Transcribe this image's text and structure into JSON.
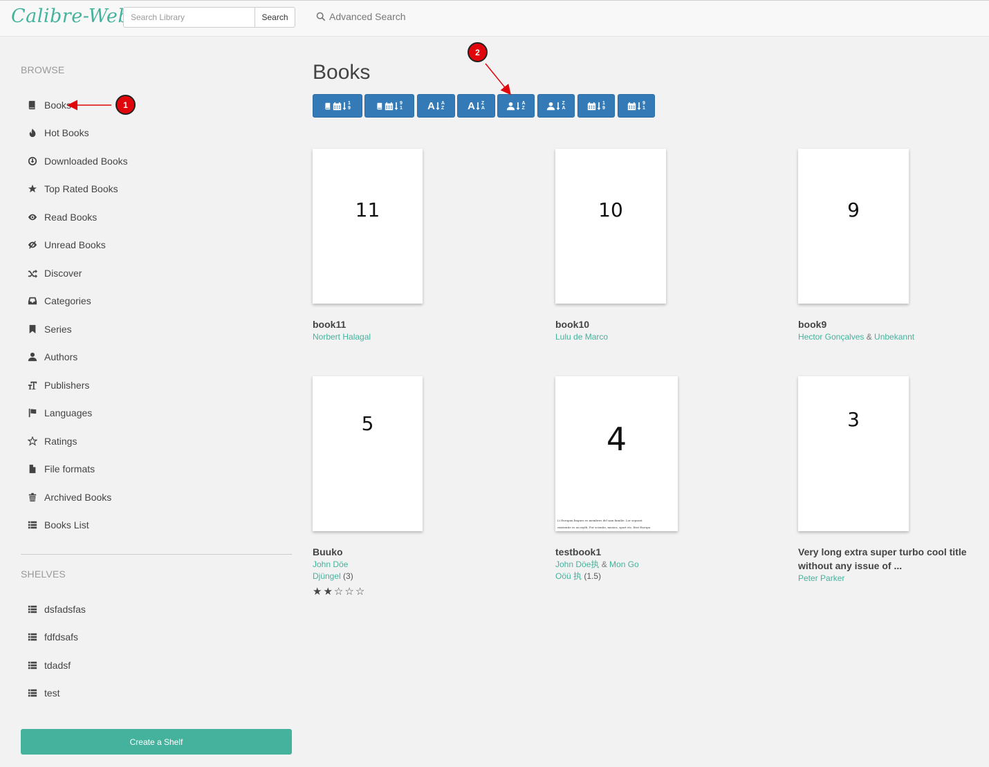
{
  "header": {
    "brand": "Calibre-Web",
    "search_placeholder": "Search Library",
    "search_button": "Search",
    "advanced_search": "Advanced Search"
  },
  "sidebar": {
    "browse_heading": "BROWSE",
    "items": [
      {
        "label": "Books",
        "icon": "book-icon"
      },
      {
        "label": "Hot Books",
        "icon": "fire-icon"
      },
      {
        "label": "Downloaded Books",
        "icon": "download-icon"
      },
      {
        "label": "Top Rated Books",
        "icon": "star-icon"
      },
      {
        "label": "Read Books",
        "icon": "eye-icon"
      },
      {
        "label": "Unread Books",
        "icon": "eye-slash-icon"
      },
      {
        "label": "Discover",
        "icon": "random-icon"
      },
      {
        "label": "Categories",
        "icon": "inbox-icon"
      },
      {
        "label": "Series",
        "icon": "bookmark-icon"
      },
      {
        "label": "Authors",
        "icon": "user-icon"
      },
      {
        "label": "Publishers",
        "icon": "text-size-icon"
      },
      {
        "label": "Languages",
        "icon": "flag-icon"
      },
      {
        "label": "Ratings",
        "icon": "star-empty-icon"
      },
      {
        "label": "File formats",
        "icon": "file-icon"
      },
      {
        "label": "Archived Books",
        "icon": "trash-icon"
      },
      {
        "label": "Books List",
        "icon": "list-icon"
      }
    ],
    "shelves_heading": "SHELVES",
    "shelves": [
      {
        "label": "dsfadsfas"
      },
      {
        "label": "fdfdsafs"
      },
      {
        "label": "tdadsf"
      },
      {
        "label": "test"
      }
    ],
    "create_shelf": "Create a Shelf"
  },
  "main": {
    "title": "Books",
    "sort_buttons": [
      {
        "name": "sort-newest-button",
        "icon": "book-calendar-sort-desc-icon"
      },
      {
        "name": "sort-oldest-button",
        "icon": "book-calendar-sort-asc-icon"
      },
      {
        "name": "sort-title-az-button",
        "icon": "alpha-sort-asc-icon"
      },
      {
        "name": "sort-title-za-button",
        "icon": "alpha-sort-desc-icon"
      },
      {
        "name": "sort-author-az-button",
        "icon": "user-sort-asc-icon"
      },
      {
        "name": "sort-author-za-button",
        "icon": "user-sort-desc-icon"
      },
      {
        "name": "sort-pubdate-newest-button",
        "icon": "calendar-sort-desc-icon"
      },
      {
        "name": "sort-pubdate-oldest-button",
        "icon": "calendar-sort-asc-icon"
      }
    ],
    "books": [
      {
        "cover_text": "11",
        "title": "book11",
        "authors": [
          "Norbert Halagal"
        ]
      },
      {
        "cover_text": "10",
        "title": "book10",
        "authors": [
          "Lulu de Marco"
        ]
      },
      {
        "cover_text": "9",
        "title": "book9",
        "authors": [
          "Hector Gonçalves",
          "Unbekannt"
        ]
      },
      {
        "cover_text": "5",
        "title": "Buuko",
        "authors": [
          "John Döe"
        ],
        "series": "Djüngel",
        "series_index": "(3)",
        "rating": 2,
        "rating_max": 5
      },
      {
        "cover_text": "4",
        "title": "testbook1",
        "authors": [
          "John Döe执",
          "Mon Go"
        ],
        "series": "Oöü 执",
        "series_index": "(1.5)",
        "cover_small_text": [
          "Li Europan lingues es membres del sam familie. Lor separat",
          "existentie es un myth. Por scientie, musica, sport etc, litot Europa"
        ]
      },
      {
        "cover_text": "3",
        "title": "Very long extra super turbo cool title without any issue of ...",
        "authors": [
          "Peter Parker"
        ]
      }
    ]
  },
  "annotations": {
    "marker_1": "1",
    "marker_2": "2",
    "color": "#e0060b"
  }
}
